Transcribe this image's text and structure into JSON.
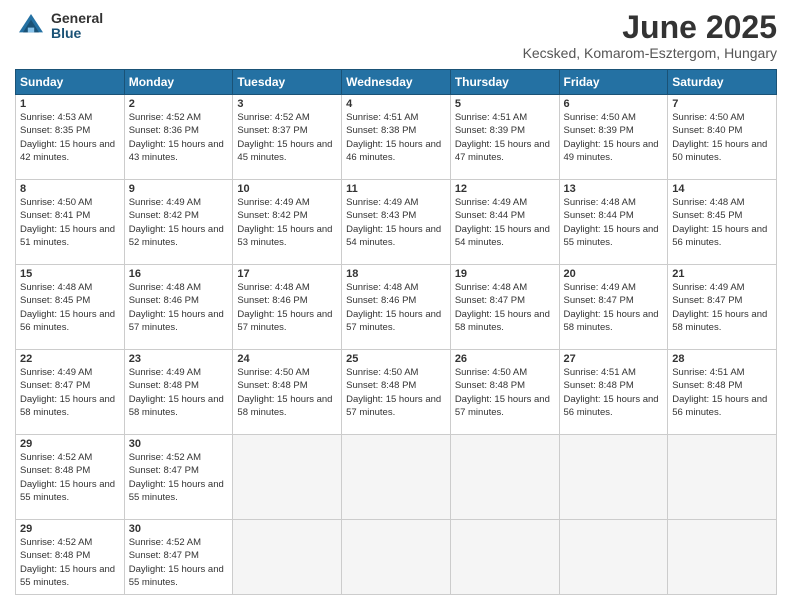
{
  "logo": {
    "general": "General",
    "blue": "Blue"
  },
  "title": "June 2025",
  "location": "Kecsked, Komarom-Esztergom, Hungary",
  "headers": [
    "Sunday",
    "Monday",
    "Tuesday",
    "Wednesday",
    "Thursday",
    "Friday",
    "Saturday"
  ],
  "days": [
    {
      "num": "",
      "sunrise": "",
      "sunset": "",
      "daylight": ""
    },
    {
      "num": "",
      "sunrise": "",
      "sunset": "",
      "daylight": ""
    },
    {
      "num": "",
      "sunrise": "",
      "sunset": "",
      "daylight": ""
    },
    {
      "num": "",
      "sunrise": "",
      "sunset": "",
      "daylight": ""
    },
    {
      "num": "",
      "sunrise": "",
      "sunset": "",
      "daylight": ""
    },
    {
      "num": "",
      "sunrise": "",
      "sunset": "",
      "daylight": ""
    },
    {
      "num": "1",
      "sunrise": "Sunrise: 4:53 AM",
      "sunset": "Sunset: 8:35 PM",
      "daylight": "Daylight: 15 hours and 42 minutes."
    },
    {
      "num": "2",
      "sunrise": "Sunrise: 4:52 AM",
      "sunset": "Sunset: 8:36 PM",
      "daylight": "Daylight: 15 hours and 43 minutes."
    },
    {
      "num": "3",
      "sunrise": "Sunrise: 4:52 AM",
      "sunset": "Sunset: 8:37 PM",
      "daylight": "Daylight: 15 hours and 45 minutes."
    },
    {
      "num": "4",
      "sunrise": "Sunrise: 4:51 AM",
      "sunset": "Sunset: 8:38 PM",
      "daylight": "Daylight: 15 hours and 46 minutes."
    },
    {
      "num": "5",
      "sunrise": "Sunrise: 4:51 AM",
      "sunset": "Sunset: 8:39 PM",
      "daylight": "Daylight: 15 hours and 47 minutes."
    },
    {
      "num": "6",
      "sunrise": "Sunrise: 4:50 AM",
      "sunset": "Sunset: 8:39 PM",
      "daylight": "Daylight: 15 hours and 49 minutes."
    },
    {
      "num": "7",
      "sunrise": "Sunrise: 4:50 AM",
      "sunset": "Sunset: 8:40 PM",
      "daylight": "Daylight: 15 hours and 50 minutes."
    },
    {
      "num": "8",
      "sunrise": "Sunrise: 4:50 AM",
      "sunset": "Sunset: 8:41 PM",
      "daylight": "Daylight: 15 hours and 51 minutes."
    },
    {
      "num": "9",
      "sunrise": "Sunrise: 4:49 AM",
      "sunset": "Sunset: 8:42 PM",
      "daylight": "Daylight: 15 hours and 52 minutes."
    },
    {
      "num": "10",
      "sunrise": "Sunrise: 4:49 AM",
      "sunset": "Sunset: 8:42 PM",
      "daylight": "Daylight: 15 hours and 53 minutes."
    },
    {
      "num": "11",
      "sunrise": "Sunrise: 4:49 AM",
      "sunset": "Sunset: 8:43 PM",
      "daylight": "Daylight: 15 hours and 54 minutes."
    },
    {
      "num": "12",
      "sunrise": "Sunrise: 4:49 AM",
      "sunset": "Sunset: 8:44 PM",
      "daylight": "Daylight: 15 hours and 54 minutes."
    },
    {
      "num": "13",
      "sunrise": "Sunrise: 4:48 AM",
      "sunset": "Sunset: 8:44 PM",
      "daylight": "Daylight: 15 hours and 55 minutes."
    },
    {
      "num": "14",
      "sunrise": "Sunrise: 4:48 AM",
      "sunset": "Sunset: 8:45 PM",
      "daylight": "Daylight: 15 hours and 56 minutes."
    },
    {
      "num": "15",
      "sunrise": "Sunrise: 4:48 AM",
      "sunset": "Sunset: 8:45 PM",
      "daylight": "Daylight: 15 hours and 56 minutes."
    },
    {
      "num": "16",
      "sunrise": "Sunrise: 4:48 AM",
      "sunset": "Sunset: 8:46 PM",
      "daylight": "Daylight: 15 hours and 57 minutes."
    },
    {
      "num": "17",
      "sunrise": "Sunrise: 4:48 AM",
      "sunset": "Sunset: 8:46 PM",
      "daylight": "Daylight: 15 hours and 57 minutes."
    },
    {
      "num": "18",
      "sunrise": "Sunrise: 4:48 AM",
      "sunset": "Sunset: 8:46 PM",
      "daylight": "Daylight: 15 hours and 57 minutes."
    },
    {
      "num": "19",
      "sunrise": "Sunrise: 4:48 AM",
      "sunset": "Sunset: 8:47 PM",
      "daylight": "Daylight: 15 hours and 58 minutes."
    },
    {
      "num": "20",
      "sunrise": "Sunrise: 4:49 AM",
      "sunset": "Sunset: 8:47 PM",
      "daylight": "Daylight: 15 hours and 58 minutes."
    },
    {
      "num": "21",
      "sunrise": "Sunrise: 4:49 AM",
      "sunset": "Sunset: 8:47 PM",
      "daylight": "Daylight: 15 hours and 58 minutes."
    },
    {
      "num": "22",
      "sunrise": "Sunrise: 4:49 AM",
      "sunset": "Sunset: 8:47 PM",
      "daylight": "Daylight: 15 hours and 58 minutes."
    },
    {
      "num": "23",
      "sunrise": "Sunrise: 4:49 AM",
      "sunset": "Sunset: 8:48 PM",
      "daylight": "Daylight: 15 hours and 58 minutes."
    },
    {
      "num": "24",
      "sunrise": "Sunrise: 4:50 AM",
      "sunset": "Sunset: 8:48 PM",
      "daylight": "Daylight: 15 hours and 58 minutes."
    },
    {
      "num": "25",
      "sunrise": "Sunrise: 4:50 AM",
      "sunset": "Sunset: 8:48 PM",
      "daylight": "Daylight: 15 hours and 57 minutes."
    },
    {
      "num": "26",
      "sunrise": "Sunrise: 4:50 AM",
      "sunset": "Sunset: 8:48 PM",
      "daylight": "Daylight: 15 hours and 57 minutes."
    },
    {
      "num": "27",
      "sunrise": "Sunrise: 4:51 AM",
      "sunset": "Sunset: 8:48 PM",
      "daylight": "Daylight: 15 hours and 56 minutes."
    },
    {
      "num": "28",
      "sunrise": "Sunrise: 4:51 AM",
      "sunset": "Sunset: 8:48 PM",
      "daylight": "Daylight: 15 hours and 56 minutes."
    },
    {
      "num": "29",
      "sunrise": "Sunrise: 4:52 AM",
      "sunset": "Sunset: 8:48 PM",
      "daylight": "Daylight: 15 hours and 55 minutes."
    },
    {
      "num": "30",
      "sunrise": "Sunrise: 4:52 AM",
      "sunset": "Sunset: 8:47 PM",
      "daylight": "Daylight: 15 hours and 55 minutes."
    }
  ]
}
